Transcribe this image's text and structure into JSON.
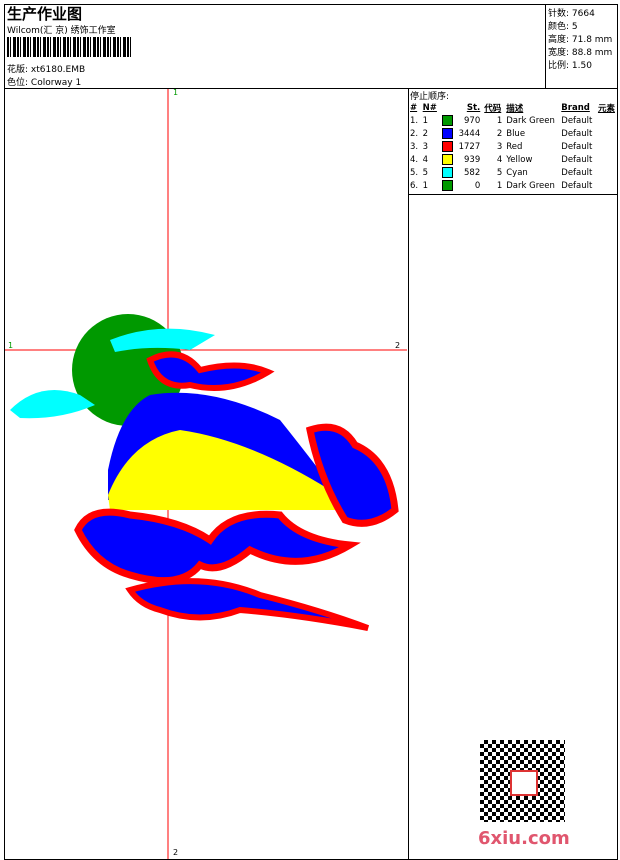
{
  "header": {
    "title": "生产作业图",
    "company": "Wilcom(汇 京) 绣饰工作室",
    "design_label": "花版:",
    "design_value": "xt6180.EMB",
    "colorway_label": "色位:",
    "colorway_value": "Colorway 1"
  },
  "info": {
    "stitches": "针数: 7664",
    "colors": "颜色: 5",
    "height": "高度: 71.8 mm",
    "width": "宽度: 88.8 mm",
    "scale": "比例: 1.50"
  },
  "stop_sequence": {
    "title": "停止顺序:",
    "columns": [
      "#",
      "N#",
      "St.",
      "代码",
      "描述",
      "Brand",
      "元素"
    ],
    "rows": [
      {
        "idx": "1.",
        "n": "1",
        "color": "#009900",
        "st": "970",
        "code": "1",
        "desc": "Dark Green",
        "brand": "Default"
      },
      {
        "idx": "2.",
        "n": "2",
        "color": "#0000ff",
        "st": "3444",
        "code": "2",
        "desc": "Blue",
        "brand": "Default"
      },
      {
        "idx": "3.",
        "n": "3",
        "color": "#ff0000",
        "st": "1727",
        "code": "3",
        "desc": "Red",
        "brand": "Default"
      },
      {
        "idx": "4.",
        "n": "4",
        "color": "#ffff00",
        "st": "939",
        "code": "4",
        "desc": "Yellow",
        "brand": "Default"
      },
      {
        "idx": "5.",
        "n": "5",
        "color": "#00ffff",
        "st": "582",
        "code": "5",
        "desc": "Cyan",
        "brand": "Default"
      },
      {
        "idx": "6.",
        "n": "1",
        "color": "#009900",
        "st": "0",
        "code": "1",
        "desc": "Dark Green",
        "brand": "Default"
      }
    ]
  },
  "crosshair": {
    "top": "1",
    "left": "1",
    "right": "2",
    "bottom": "2"
  },
  "watermark": "6xiu.com"
}
